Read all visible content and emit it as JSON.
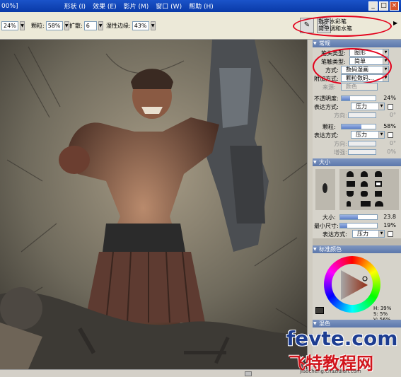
{
  "window": {
    "title_fragment": "00%]",
    "menu": [
      "形状 (I)",
      "效果 (E)",
      "影片 (M)",
      "窗口 (W)",
      "帮助 (H)"
    ],
    "menu_lead": "①",
    "buttons": [
      "_",
      "□",
      "×"
    ]
  },
  "property_bar": {
    "size_value": "24%",
    "grain_label": "颗粒:",
    "grain_value": "58%",
    "expand_label": "扩散:",
    "expand_value": "6",
    "edge_label": "湿性边缘:",
    "edge_value": "43%",
    "brush_category": "数字水彩笔",
    "brush_variant": "简单调和水笔"
  },
  "general_panel": {
    "title": "常规",
    "dab_type_label": "笔头类型:",
    "dab_type_value": "图形",
    "stroke_type_label": "笔触类型:",
    "stroke_type_value": "简单",
    "method_label": "方式:",
    "method_value": "数码湿画",
    "subcategory_label": "附加方式:",
    "subcategory_value": "颗粒数码...",
    "source_label": "来源:",
    "source_value": "颜色",
    "opacity_label": "不透明度:",
    "opacity_value": "24%",
    "opacity_fraction": 0.24,
    "expression1_label": "表达方式:",
    "expression1_value": "压力",
    "direction1_label": "方向:",
    "direction1_value": "0°",
    "grain_label": "颗粒:",
    "grain_value": "58%",
    "grain_fraction": 0.58,
    "expression2_label": "表达方式:",
    "expression2_value": "压力",
    "direction2_label": "方向:",
    "direction2_value": "0°",
    "boost_label": "增强:",
    "boost_value": "0%"
  },
  "size_panel": {
    "title": "大小",
    "size_label": "大小:",
    "size_value": "23.8",
    "size_fraction": 0.48,
    "min_size_label": "最小尺寸:",
    "min_size_value": "19%",
    "min_size_fraction": 0.19,
    "expression_label": "表达方式:",
    "expression_value": "压力"
  },
  "color_panel": {
    "title": "标准颜色",
    "h_value": "H: 39%",
    "s_value": "S: 5%",
    "v_value": "V: 56%",
    "mixer_title": "混色"
  },
  "watermark": {
    "site": "fevte.com",
    "cn": "飞特教程网",
    "url": "jiaocheng.chazidian.com"
  },
  "colors": {
    "accent_red": "#e3001b",
    "panel_head": "#5b77ab",
    "watermark_blue": "#1d3d91"
  }
}
